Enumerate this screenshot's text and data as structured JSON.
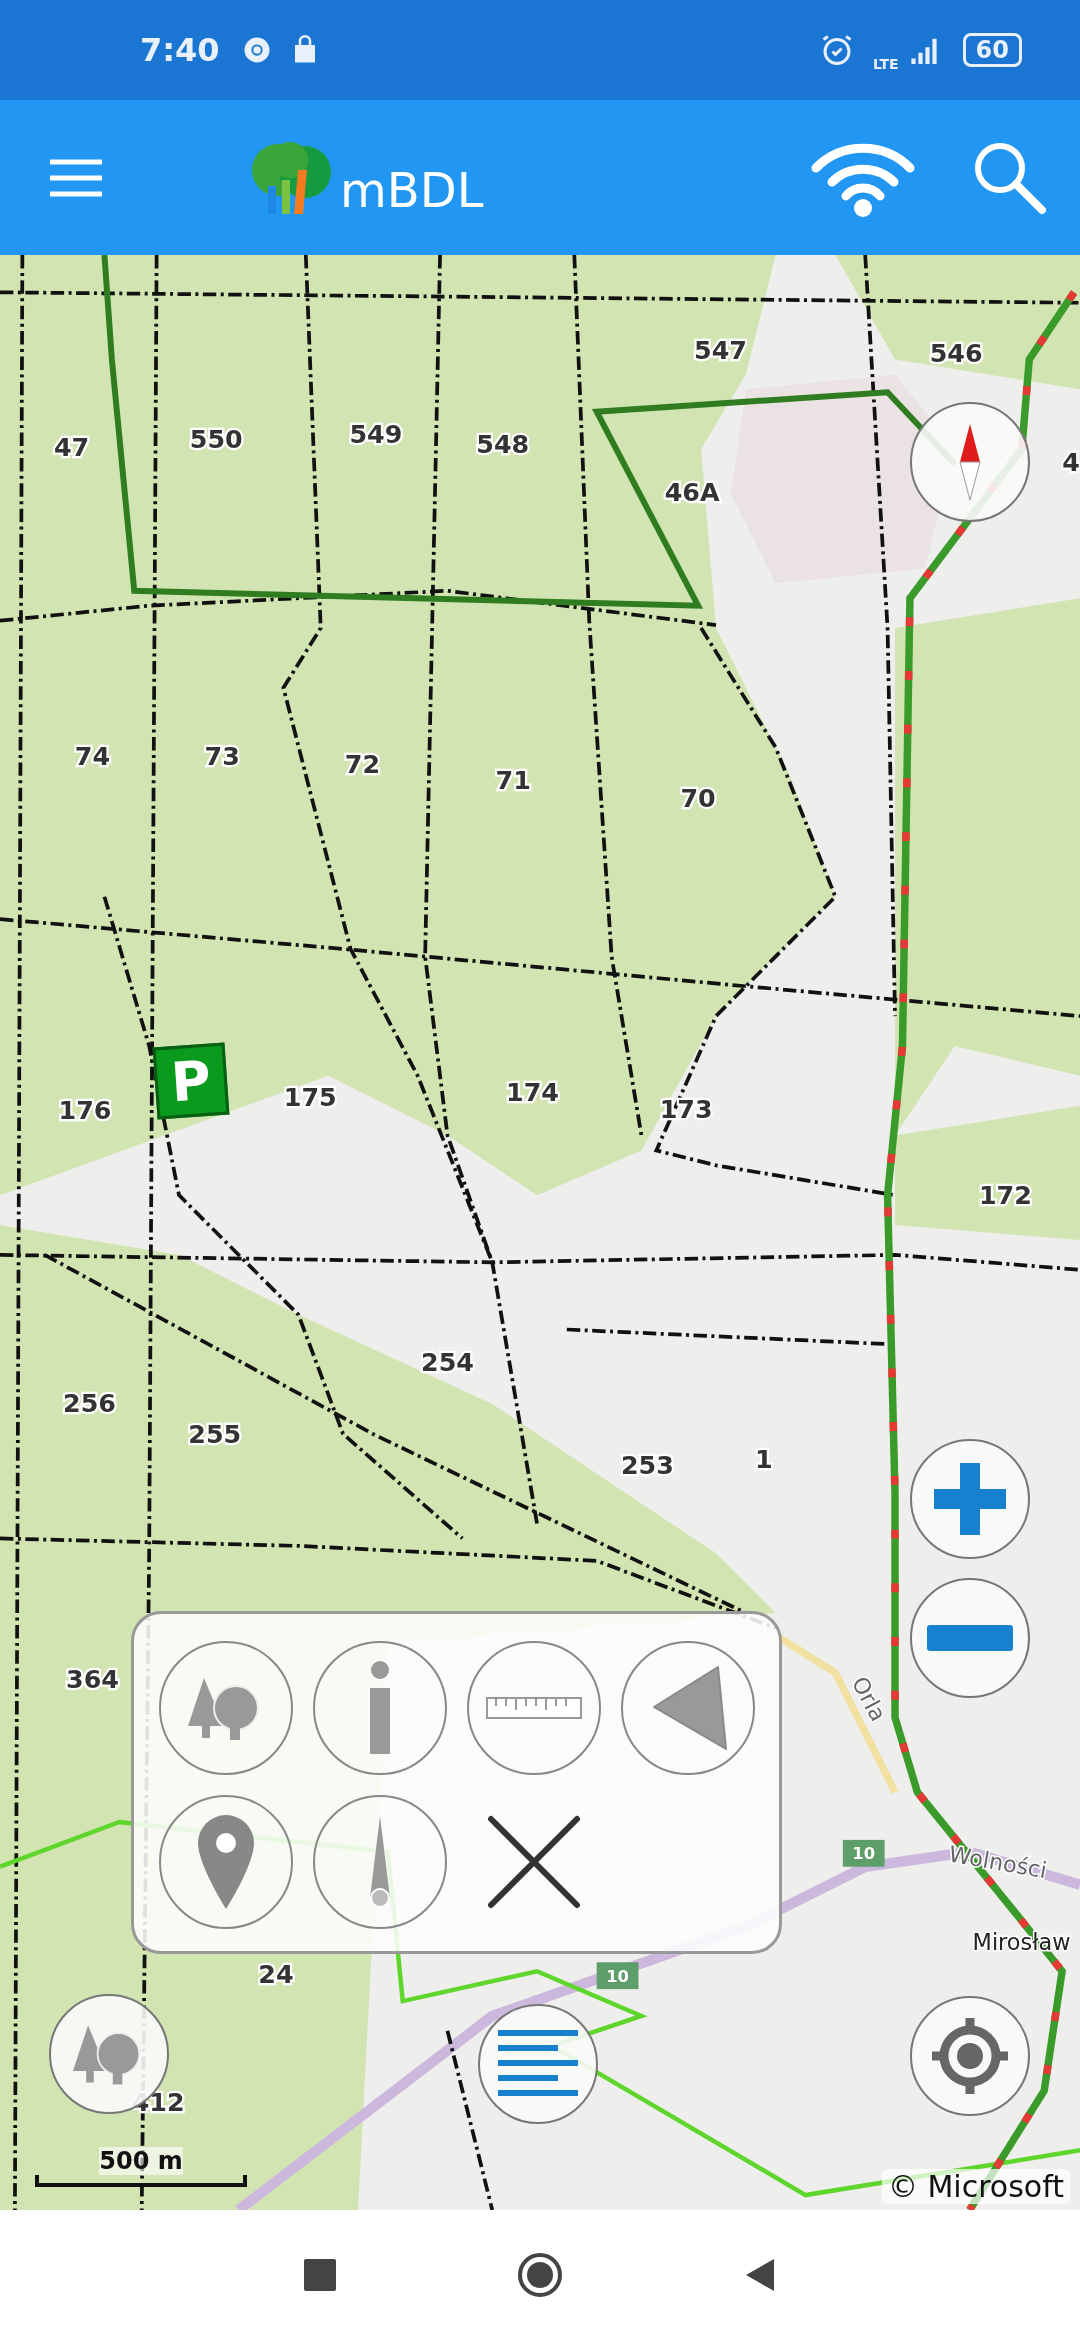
{
  "status_bar": {
    "time": "7:40",
    "network": "LTE",
    "battery": "60"
  },
  "app_bar": {
    "title": "mBDL"
  },
  "map": {
    "labels": [
      {
        "text": "47",
        "kind": "compartment"
      },
      {
        "text": "550",
        "kind": "compartment"
      },
      {
        "text": "549",
        "kind": "compartment"
      },
      {
        "text": "548",
        "kind": "compartment"
      },
      {
        "text": "547",
        "kind": "compartment"
      },
      {
        "text": "546",
        "kind": "compartment"
      },
      {
        "text": "46A",
        "kind": "compartment"
      },
      {
        "text": "4",
        "kind": "compartment"
      },
      {
        "text": "74",
        "kind": "compartment"
      },
      {
        "text": "73",
        "kind": "compartment"
      },
      {
        "text": "72",
        "kind": "compartment"
      },
      {
        "text": "71",
        "kind": "compartment"
      },
      {
        "text": "70",
        "kind": "compartment"
      },
      {
        "text": "176",
        "kind": "compartment"
      },
      {
        "text": "175",
        "kind": "compartment"
      },
      {
        "text": "174",
        "kind": "compartment"
      },
      {
        "text": "173",
        "kind": "compartment"
      },
      {
        "text": "172",
        "kind": "compartment"
      },
      {
        "text": "254",
        "kind": "compartment"
      },
      {
        "text": "256",
        "kind": "compartment"
      },
      {
        "text": "255",
        "kind": "compartment"
      },
      {
        "text": "253",
        "kind": "compartment"
      },
      {
        "text": "1",
        "kind": "compartment"
      },
      {
        "text": "364",
        "kind": "compartment"
      },
      {
        "text": "24",
        "kind": "compartment"
      },
      {
        "text": "412",
        "kind": "compartment"
      },
      {
        "text": "Orla",
        "kind": "street"
      },
      {
        "text": "Wolności",
        "kind": "street"
      },
      {
        "text": "10",
        "kind": "route"
      },
      {
        "text": "10",
        "kind": "route"
      },
      {
        "text": "Mirosław",
        "kind": "place"
      }
    ],
    "parking_sign": "P",
    "scale": "500 m",
    "attribution": "© Microsoft"
  }
}
